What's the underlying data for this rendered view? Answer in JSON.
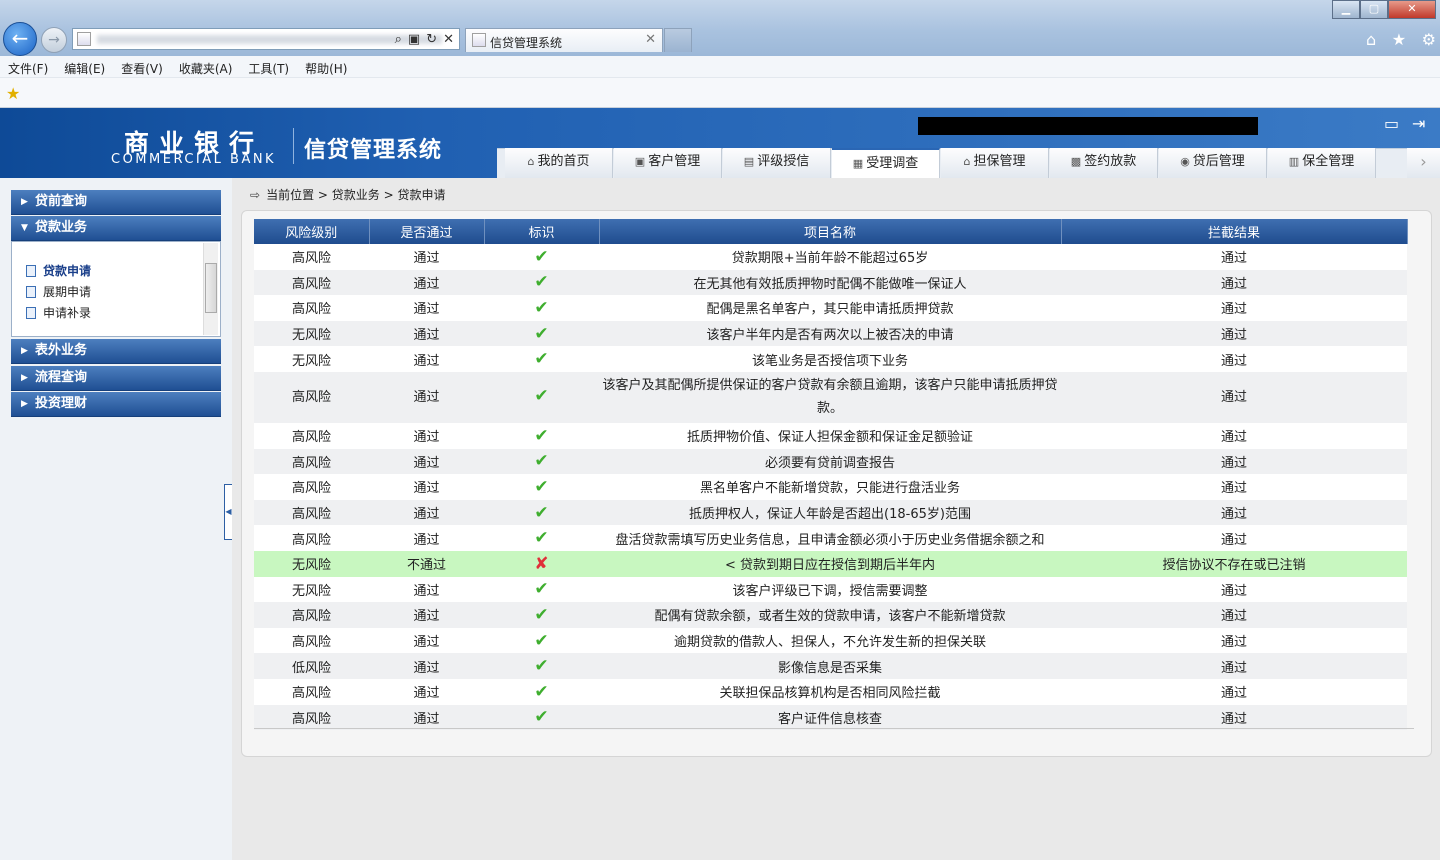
{
  "browser": {
    "tab_title": "信贷管理系统",
    "menu": [
      "文件(F)",
      "编辑(E)",
      "查看(V)",
      "收藏夹(A)",
      "工具(T)",
      "帮助(H)"
    ]
  },
  "header": {
    "bank_cn": "商业银行",
    "bank_en": "COMMERCIAL BANK",
    "system_name": "信贷管理系统"
  },
  "nav": {
    "tabs": [
      {
        "label": "我的首页",
        "icon": "home-icon",
        "glyph": "⌂"
      },
      {
        "label": "客户管理",
        "icon": "customer-icon",
        "glyph": "▣"
      },
      {
        "label": "评级授信",
        "icon": "rating-icon",
        "glyph": "▤"
      },
      {
        "label": "受理调查",
        "icon": "survey-icon",
        "glyph": "▦"
      },
      {
        "label": "担保管理",
        "icon": "guarantee-icon",
        "glyph": "⌂"
      },
      {
        "label": "签约放款",
        "icon": "contract-icon",
        "glyph": "▩"
      },
      {
        "label": "贷后管理",
        "icon": "postloan-icon",
        "glyph": "◉"
      },
      {
        "label": "保全管理",
        "icon": "preservation-icon",
        "glyph": "▥"
      }
    ],
    "active_index": 3
  },
  "sidebar": {
    "groups": [
      "贷前查询",
      "贷款业务",
      "表外业务",
      "流程查询",
      "投资理财"
    ],
    "loan_items": [
      "贷款申请",
      "展期申请",
      "申请补录"
    ],
    "active_item": "贷款申请"
  },
  "breadcrumb": {
    "prefix": "当前位置",
    "path": "贷款业务",
    "current": "贷款申请",
    "sep": ">"
  },
  "table": {
    "columns": [
      "风险级别",
      "是否通过",
      "标识",
      "项目名称",
      "拦截结果"
    ],
    "rows": [
      {
        "risk": "高风险",
        "pass": "通过",
        "ok": true,
        "name": "贷款期限+当前年龄不能超过65岁",
        "result": "通过"
      },
      {
        "risk": "高风险",
        "pass": "通过",
        "ok": true,
        "name": "在无其他有效抵质押物时配偶不能做唯一保证人",
        "result": "通过"
      },
      {
        "risk": "高风险",
        "pass": "通过",
        "ok": true,
        "name": "配偶是黑名单客户，其只能申请抵质押贷款",
        "result": "通过"
      },
      {
        "risk": "无风险",
        "pass": "通过",
        "ok": true,
        "name": "该客户半年内是否有两次以上被否决的申请",
        "result": "通过"
      },
      {
        "risk": "无风险",
        "pass": "通过",
        "ok": true,
        "name": "该笔业务是否授信项下业务",
        "result": "通过"
      },
      {
        "risk": "高风险",
        "pass": "通过",
        "ok": true,
        "name": "该客户及其配偶所提供保证的客户贷款有余额且逾期，该客户只能申请抵质押贷款。",
        "result": "通过",
        "tall": true
      },
      {
        "risk": "高风险",
        "pass": "通过",
        "ok": true,
        "name": "抵质押物价值、保证人担保金额和保证金足额验证",
        "result": "通过"
      },
      {
        "risk": "高风险",
        "pass": "通过",
        "ok": true,
        "name": "必须要有贷前调查报告",
        "result": "通过"
      },
      {
        "risk": "高风险",
        "pass": "通过",
        "ok": true,
        "name": "黑名单客户不能新增贷款，只能进行盘活业务",
        "result": "通过"
      },
      {
        "risk": "高风险",
        "pass": "通过",
        "ok": true,
        "name": "抵质押权人，保证人年龄是否超出(18-65岁)范围",
        "result": "通过"
      },
      {
        "risk": "高风险",
        "pass": "通过",
        "ok": true,
        "name": "盘活贷款需填写历史业务信息，且申请金额必须小于历史业务借据余额之和",
        "result": "通过"
      },
      {
        "risk": "无风险",
        "pass": "不通过",
        "ok": false,
        "name": "< 贷款到期日应在授信到期后半年内",
        "result": "授信协议不存在或已注销"
      },
      {
        "risk": "无风险",
        "pass": "通过",
        "ok": true,
        "name": "该客户评级已下调，授信需要调整",
        "result": "通过"
      },
      {
        "risk": "高风险",
        "pass": "通过",
        "ok": true,
        "name": "配偶有贷款余额，或者生效的贷款申请，该客户不能新增贷款",
        "result": "通过"
      },
      {
        "risk": "高风险",
        "pass": "通过",
        "ok": true,
        "name": "逾期贷款的借款人、担保人，不允许发生新的担保关联",
        "result": "通过"
      },
      {
        "risk": "低风险",
        "pass": "通过",
        "ok": true,
        "name": "影像信息是否采集",
        "result": "通过"
      },
      {
        "risk": "高风险",
        "pass": "通过",
        "ok": true,
        "name": "关联担保品核算机构是否相同风险拦截",
        "result": "通过"
      },
      {
        "risk": "高风险",
        "pass": "通过",
        "ok": true,
        "name": "客户证件信息核查",
        "result": "通过"
      }
    ]
  },
  "colors": {
    "header_blue": "#1f4c8e",
    "pass_green": "#3fae2f",
    "fail_red": "#e0303a",
    "fail_row": "#c8f7c0"
  }
}
